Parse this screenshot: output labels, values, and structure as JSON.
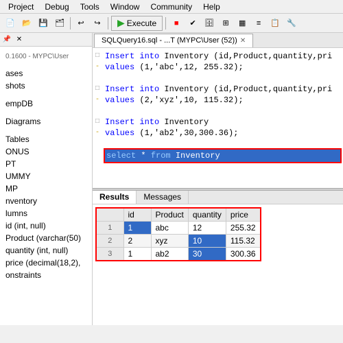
{
  "menubar": {
    "items": [
      "Project",
      "Debug",
      "Tools",
      "Window",
      "Community",
      "Help"
    ]
  },
  "toolbar": {
    "execute_label": "Execute",
    "execute_arrow": "▶"
  },
  "leftpanel": {
    "connection": "0.1600 - MYPC\\User",
    "items": [
      {
        "label": "ases",
        "indent": 0
      },
      {
        "label": "shots",
        "indent": 0
      },
      {
        "label": "",
        "indent": 0
      },
      {
        "label": "empDB",
        "indent": 0
      },
      {
        "label": "",
        "indent": 0
      },
      {
        "label": "Diagrams",
        "indent": 0
      },
      {
        "label": "",
        "indent": 0
      },
      {
        "label": "Tables",
        "indent": 0
      },
      {
        "label": "ONUS",
        "indent": 0
      },
      {
        "label": "PT",
        "indent": 0
      },
      {
        "label": "UMMY",
        "indent": 0
      },
      {
        "label": "MP",
        "indent": 0
      },
      {
        "label": "nventory",
        "indent": 0
      },
      {
        "label": "lumns",
        "indent": 0
      },
      {
        "label": "id (int, null)",
        "indent": 0
      },
      {
        "label": "Product (varchar(50)",
        "indent": 0
      },
      {
        "label": "quantity (int, null)",
        "indent": 0
      },
      {
        "label": "price (decimal(18,2),",
        "indent": 0
      },
      {
        "label": "onstraints",
        "indent": 0
      }
    ]
  },
  "tab": {
    "title": "SQLQuery16.sql - ...T (MYPC\\User (52))",
    "close": "✕"
  },
  "code": {
    "lines": [
      {
        "marker": "□",
        "marker_class": "",
        "text": "Insert into Inventory (id,Product,quantity,pri",
        "highlight": false
      },
      {
        "marker": "-",
        "marker_class": "yellow",
        "text": "values (1,'abc',12, 255.32);",
        "highlight": false
      },
      {
        "marker": "",
        "marker_class": "",
        "text": "",
        "highlight": false
      },
      {
        "marker": "□",
        "marker_class": "",
        "text": "Insert into Inventory (id,Product,quantity,pri",
        "highlight": false
      },
      {
        "marker": "-",
        "marker_class": "yellow",
        "text": "values (2,'xyz',10, 115.32);",
        "highlight": false
      },
      {
        "marker": "",
        "marker_class": "",
        "text": "",
        "highlight": false
      },
      {
        "marker": "□",
        "marker_class": "",
        "text": "Insert into Inventory",
        "highlight": false
      },
      {
        "marker": "-",
        "marker_class": "yellow",
        "text": "values (1,'ab2',30,300.36);",
        "highlight": false
      },
      {
        "marker": "",
        "marker_class": "",
        "text": "",
        "highlight": false
      },
      {
        "marker": "",
        "marker_class": "",
        "text": "select * from Inventory",
        "highlight": true
      }
    ]
  },
  "results": {
    "tabs": [
      "Results",
      "Messages"
    ],
    "active_tab": "Results",
    "columns": [
      "",
      "id",
      "Product",
      "quantity",
      "price"
    ],
    "rows": [
      {
        "row_num": "1",
        "id": "1",
        "product": "abc",
        "quantity": "12",
        "price": "255.32",
        "selected_col": "id"
      },
      {
        "row_num": "2",
        "id": "2",
        "product": "xyz",
        "quantity": "10",
        "price": "115.32",
        "selected_col": "quantity"
      },
      {
        "row_num": "3",
        "id": "1",
        "product": "ab2",
        "quantity": "30",
        "price": "300.36",
        "selected_col": "quantity"
      }
    ]
  }
}
